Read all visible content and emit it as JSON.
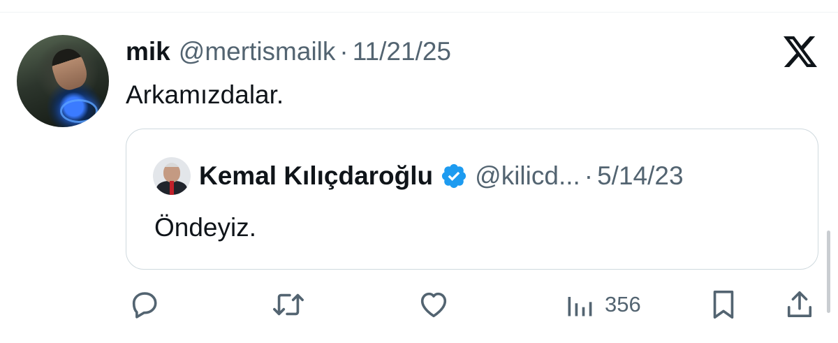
{
  "tweet": {
    "author": {
      "display_name": "mik",
      "handle": "@mertismailk",
      "separator": "·",
      "date": "11/21/25"
    },
    "text": "Arkamızdalar."
  },
  "quoted_tweet": {
    "author": {
      "display_name": "Kemal Kılıçdaroğlu",
      "handle": "@kilicd...",
      "separator": "·",
      "date": "5/14/23",
      "verified": true
    },
    "text": "Öndeyiz."
  },
  "actions": {
    "views": "356"
  },
  "icons": {
    "brand": "x-logo-icon",
    "verified": "verified-badge-icon",
    "reply": "reply-icon",
    "retweet": "retweet-icon",
    "like": "heart-icon",
    "views": "views-icon",
    "bookmark": "bookmark-icon",
    "share": "share-icon"
  },
  "colors": {
    "text_primary": "#0f1419",
    "text_secondary": "#536471",
    "verified_blue": "#1d9bf0",
    "border": "#cfd9de"
  }
}
